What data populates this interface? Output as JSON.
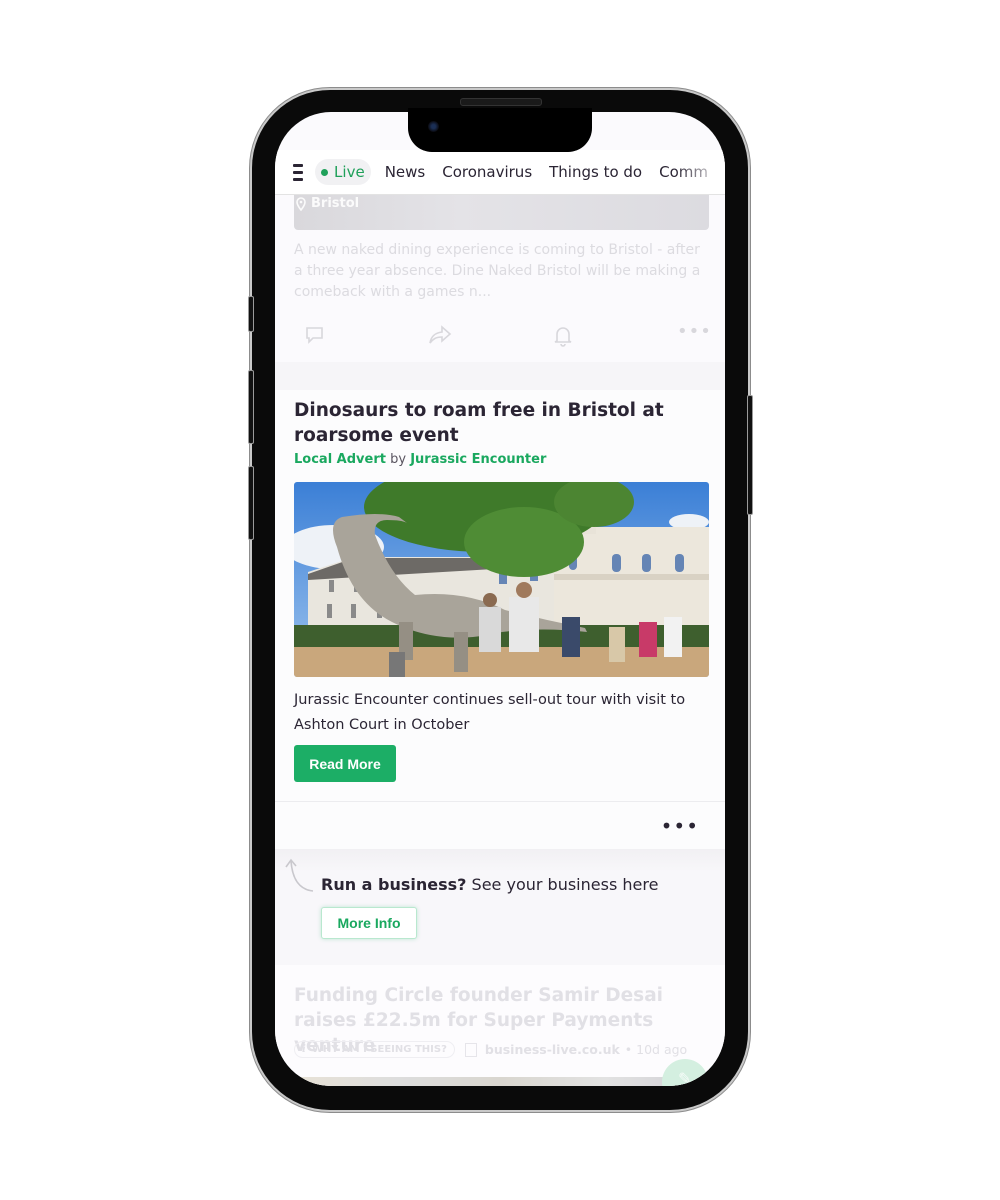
{
  "nav": {
    "live_label": "Live",
    "items": [
      "News",
      "Coronavirus",
      "Things to do",
      "Comm"
    ]
  },
  "previous_card": {
    "location": "Bristol",
    "summary": "A new naked dining experience is coming to Bristol - after a three year absence. Dine Naked Bristol will be making a comeback with a games n...",
    "actions": [
      "comment-icon",
      "share-icon",
      "bell-icon",
      "more-icon"
    ]
  },
  "ad_card": {
    "title": "Dinosaurs to roam free in Bristol at roarsome event",
    "label": "Local Advert",
    "by_word": "by",
    "advertiser": "Jurassic Encounter",
    "image_alt": "Animatronic dinosaur outside Ashton Court mansion with visitors",
    "description": "Jurassic Encounter continues sell-out tour with visit to Ashton Court in October",
    "cta": "Read More",
    "more_label": "•••"
  },
  "promo": {
    "bold": "Run a business?",
    "text": " See your business here",
    "cta": "More Info"
  },
  "next_card": {
    "title": "Funding Circle founder Samir Desai raises £22.5m for Super Payments venture",
    "why_label": "WHY AM I SEEING THIS?",
    "source": "business-live.co.uk",
    "age": "• 10d ago"
  },
  "colors": {
    "accent_green": "#1cae66",
    "text_dark": "#2b2534"
  }
}
